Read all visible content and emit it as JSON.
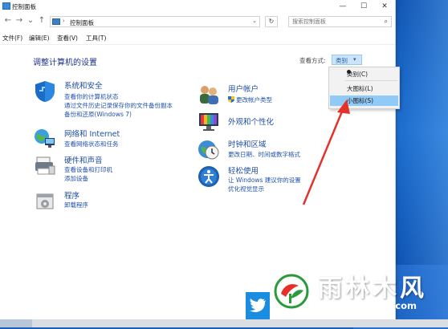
{
  "window": {
    "title": "控制面板",
    "minimize": "—",
    "maximize": "☐",
    "close": "✕"
  },
  "nav": {
    "back": "←",
    "forward": "→",
    "dropdown": "⌄",
    "up": "↑"
  },
  "address": {
    "separator": "›",
    "path": "控制面板",
    "dropdown": "⌄"
  },
  "refresh": "↻",
  "search": {
    "placeholder": "搜索控制面板",
    "icon": "⌕"
  },
  "menubar": [
    "文件(F)",
    "编辑(E)",
    "查看(V)",
    "工具(T)"
  ],
  "heading": "调整计算机的设置",
  "view_by": {
    "label": "查看方式:",
    "value": "类别",
    "caret": "▾"
  },
  "categories": {
    "system": {
      "title": "系统和安全",
      "links": [
        "查看你的计算机状态",
        "通过文件历史记录保存你的文件备份副本",
        "备份和还原(Windows 7)"
      ]
    },
    "network": {
      "title": "网络和 Internet",
      "links": [
        "查看网络状态和任务"
      ]
    },
    "hardware": {
      "title": "硬件和声音",
      "links": [
        "查看设备和打印机",
        "添加设备"
      ]
    },
    "programs": {
      "title": "程序",
      "links": [
        "卸载程序"
      ]
    },
    "users": {
      "title": "用户帐户",
      "links": [
        "更改帐户类型"
      ]
    },
    "appearance": {
      "title": "外观和个性化",
      "links": []
    },
    "clock": {
      "title": "时钟和区域",
      "links": [
        "更改日期、时间或数字格式"
      ]
    },
    "ease": {
      "title": "轻松使用",
      "links": [
        "让 Windows 建议你的设置",
        "优化视觉显示"
      ]
    }
  },
  "dropdown_menu": {
    "items": [
      "类别(C)",
      "大图标(L)",
      "小图标(S)"
    ],
    "selected": 0,
    "highlighted": 2
  },
  "watermark": {
    "name": "雨林木风",
    "url": "www.ylmf888.com"
  },
  "colors": {
    "link": "#2052b0",
    "heading": "#1e3287",
    "highlight": "#91c9f7",
    "arrow": "#e5312a"
  }
}
